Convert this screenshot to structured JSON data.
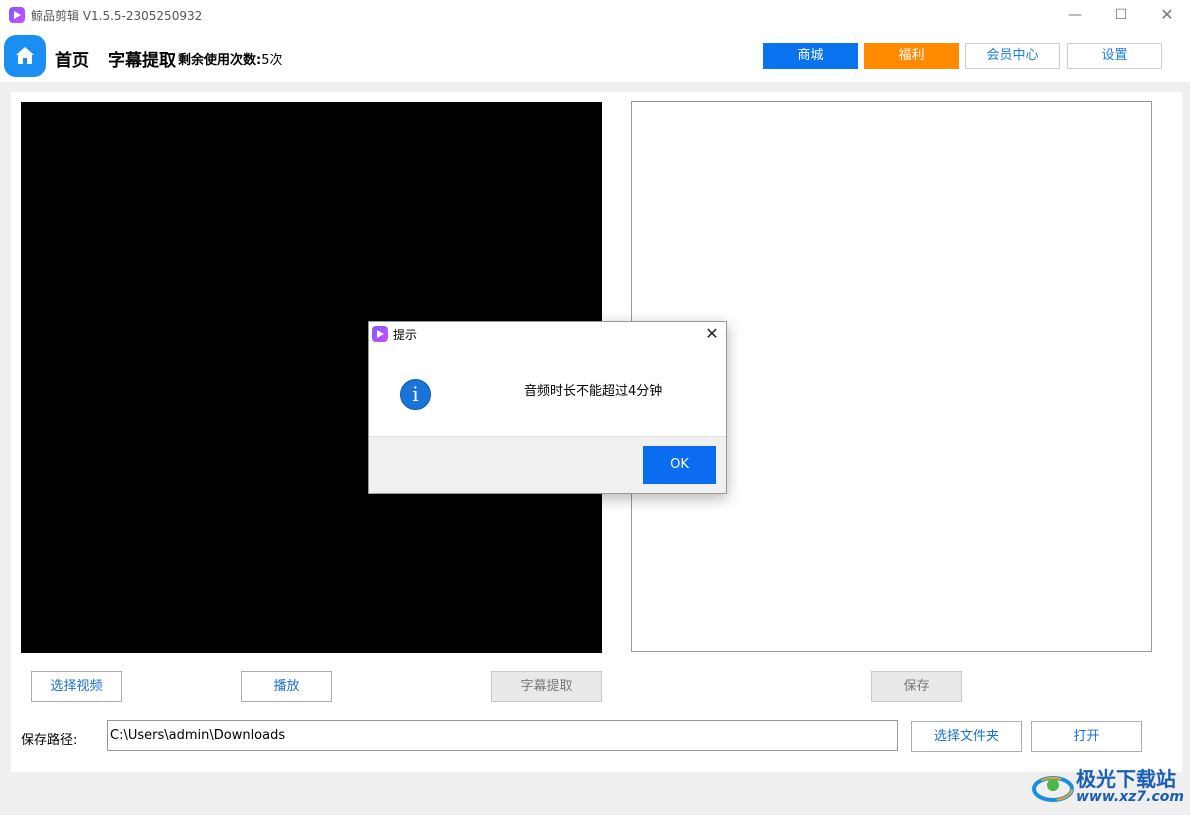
{
  "window": {
    "title": "鲸品剪辑 V1.5.5-2305250932",
    "minimize_label": "—",
    "maximize_label": "☐",
    "close_label": "✕"
  },
  "header": {
    "home_label": "首页",
    "page_title": "字幕提取",
    "remaining_label": "剩余使用次数:",
    "remaining_value": "5次",
    "buttons": {
      "mall": "商城",
      "welfare": "福利",
      "member": "会员中心",
      "settings": "设置"
    }
  },
  "actions": {
    "select_video": "选择视频",
    "play": "播放",
    "extract_subtitle": "字幕提取",
    "save": "保存"
  },
  "save_path": {
    "label": "保存路径:",
    "value": "C:\\Users\\admin\\Downloads",
    "choose_folder": "选择文件夹",
    "open": "打开"
  },
  "dialog": {
    "title": "提示",
    "message": "音频时长不能超过4分钟",
    "ok_label": "OK",
    "close_label": "✕",
    "icon_glyph": "i"
  },
  "watermark": {
    "text": "极光下载站",
    "url": "www.xz7.com"
  },
  "colors": {
    "mall": "#0a73f0",
    "welfare": "#ff8a00",
    "home_icon": "#1b8ef2",
    "ok_button": "#0a6cf0"
  }
}
